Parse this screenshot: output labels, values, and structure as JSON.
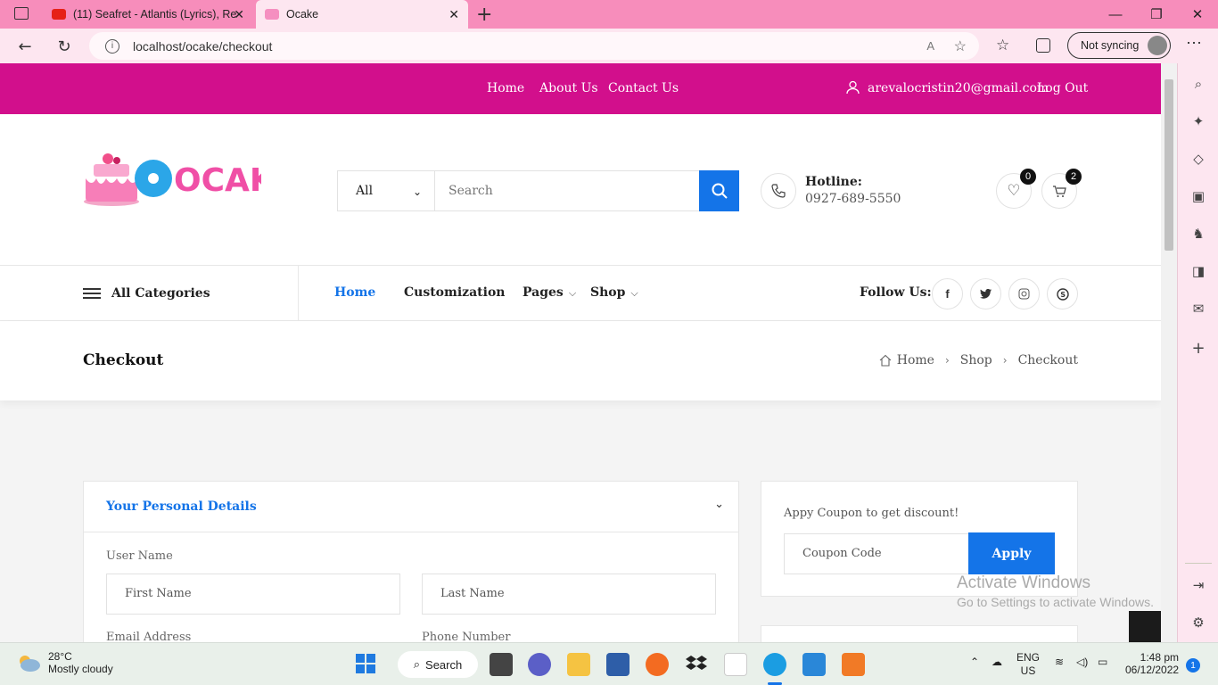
{
  "browser": {
    "tabs": [
      {
        "label": "(11) Seafret - Atlantis (Lyrics), Re"
      },
      {
        "label": "Ocake"
      }
    ],
    "url": "localhost/ocake/checkout",
    "sync_label": "Not syncing"
  },
  "topnav": {
    "links": [
      "Home",
      "About Us",
      "Contact Us"
    ],
    "user_email": "arevalocristin20@gmail.com",
    "logout": "Log Out"
  },
  "header": {
    "logo_text": "OCAKE",
    "search_category": "All",
    "search_placeholder": "Search",
    "hotline_label": "Hotline:",
    "hotline_number": "0927-689-5550",
    "wishlist_count": "0",
    "cart_count": "2"
  },
  "catbar": {
    "all_categories": "All Categories",
    "nav": [
      "Home",
      "Customization",
      "Pages",
      "Shop"
    ],
    "follow_label": "Follow Us:"
  },
  "crumbbar": {
    "title": "Checkout",
    "crumbs": [
      "Home",
      "Shop",
      "Checkout"
    ]
  },
  "personal": {
    "title": "Your Personal Details",
    "username_label": "User Name",
    "first_name_placeholder": "First Name",
    "last_name_placeholder": "Last Name",
    "email_label": "Email Address",
    "phone_label": "Phone Number"
  },
  "coupon": {
    "title": "Appy Coupon to get discount!",
    "placeholder": "Coupon Code",
    "apply": "Apply"
  },
  "watermark": {
    "line1": "Activate Windows",
    "line2": "Go to Settings to activate Windows."
  },
  "taskbar": {
    "temp": "28°C",
    "weather": "Mostly cloudy",
    "search": "Search",
    "lang1": "ENG",
    "lang2": "US",
    "time": "1:48 pm",
    "date": "06/12/2022",
    "notifications": "1"
  },
  "colors": {
    "brand_pink": "#d20f8c",
    "accent_blue": "#1474e8",
    "chrome_pink": "#f78dbb"
  }
}
